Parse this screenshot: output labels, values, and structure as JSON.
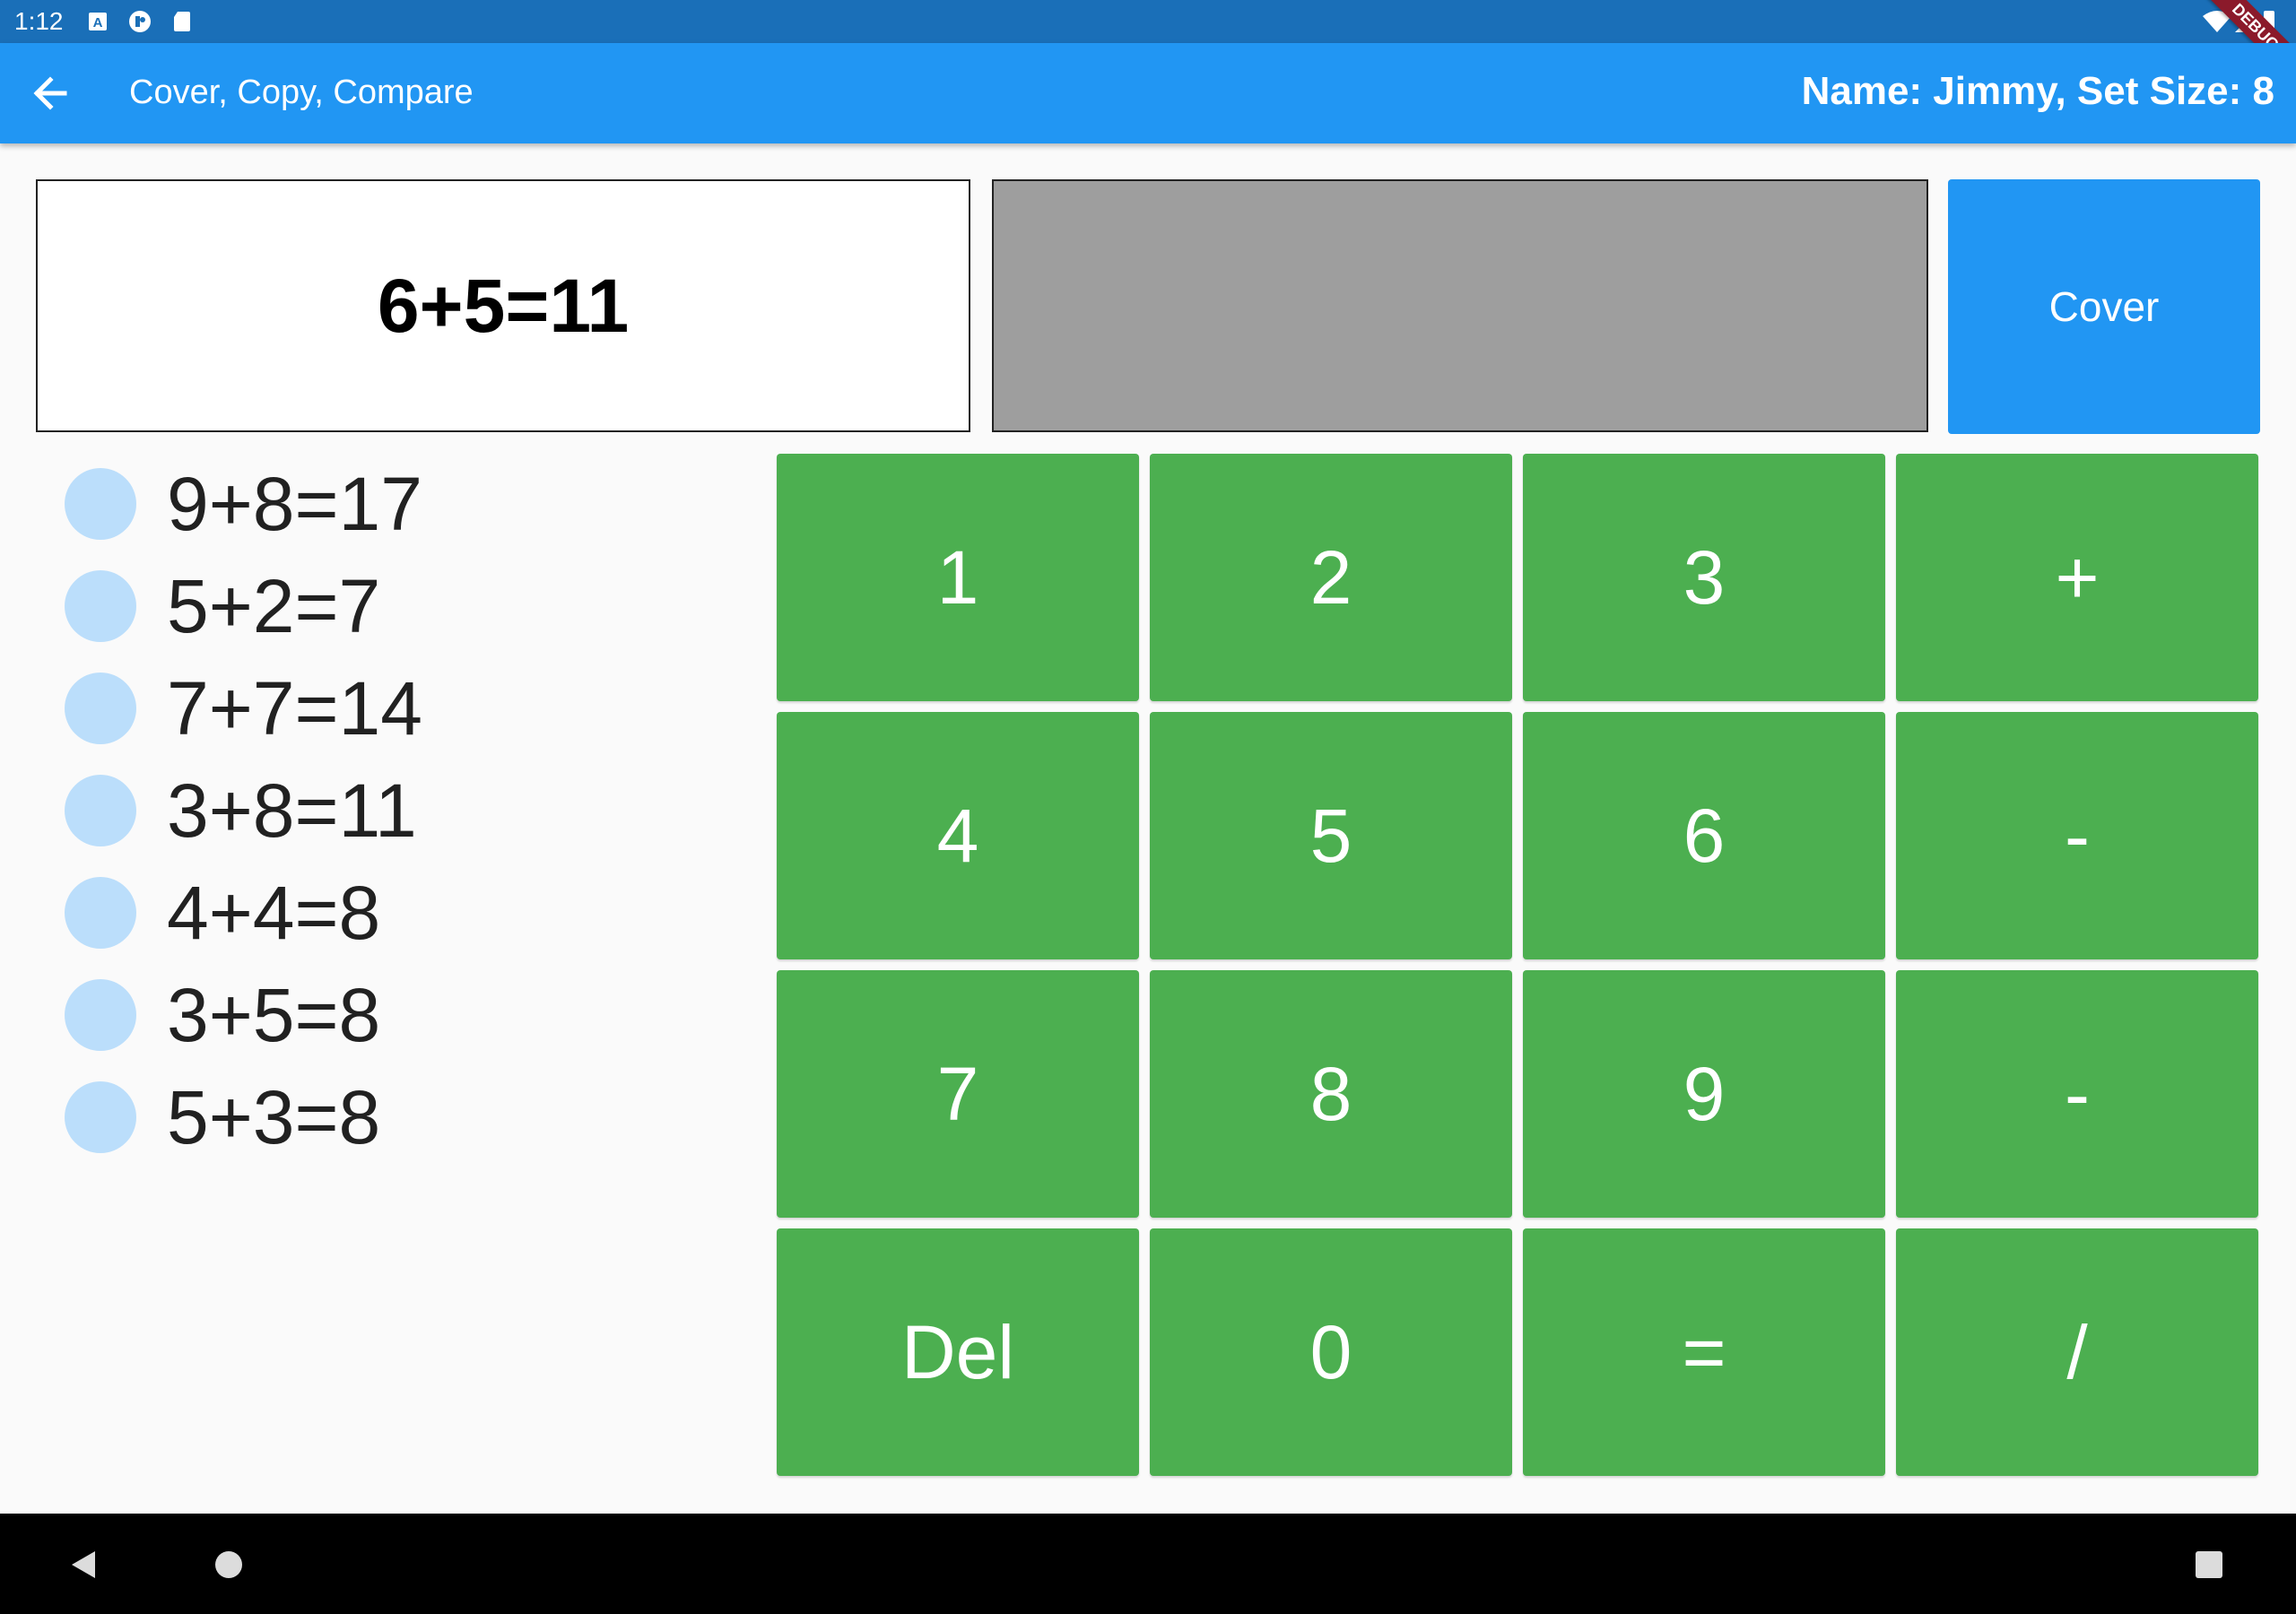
{
  "status_bar": {
    "time": "1:12",
    "icons": [
      "keyboard-icon",
      "notification-icon",
      "sd-card-icon"
    ],
    "right_icons": [
      "wifi-icon",
      "signal-icon",
      "battery-icon"
    ],
    "debug_label": "DEBUG"
  },
  "app_bar": {
    "back_icon": "arrow-back-icon",
    "title": "Cover, Copy, Compare",
    "info": "Name: Jimmy, Set Size: 8"
  },
  "problem": {
    "text": "6+5=11"
  },
  "answer": {
    "text": ""
  },
  "cover_button": {
    "label": "Cover"
  },
  "history": {
    "items": [
      {
        "text": "9+8=17"
      },
      {
        "text": "5+2=7"
      },
      {
        "text": "7+7=14"
      },
      {
        "text": "3+8=11"
      },
      {
        "text": "4+4=8"
      },
      {
        "text": "3+5=8"
      },
      {
        "text": "5+3=8"
      }
    ]
  },
  "keypad": {
    "keys": [
      {
        "label": "1"
      },
      {
        "label": "2"
      },
      {
        "label": "3"
      },
      {
        "label": "+"
      },
      {
        "label": "4"
      },
      {
        "label": "5"
      },
      {
        "label": "6"
      },
      {
        "label": "-"
      },
      {
        "label": "7"
      },
      {
        "label": "8"
      },
      {
        "label": "9"
      },
      {
        "label": "-"
      },
      {
        "label": "Del"
      },
      {
        "label": "0"
      },
      {
        "label": "="
      },
      {
        "label": "/"
      }
    ]
  },
  "nav_bar": {
    "icons": [
      "nav-back-icon",
      "nav-home-icon",
      "nav-recent-icon"
    ]
  },
  "colors": {
    "status_bar": "#1a6fb8",
    "app_bar": "#2196f3",
    "cover_button": "#2196f3",
    "keypad": "#4caf50",
    "answer_card": "#9e9e9e",
    "history_dot": "#bbdefb"
  }
}
